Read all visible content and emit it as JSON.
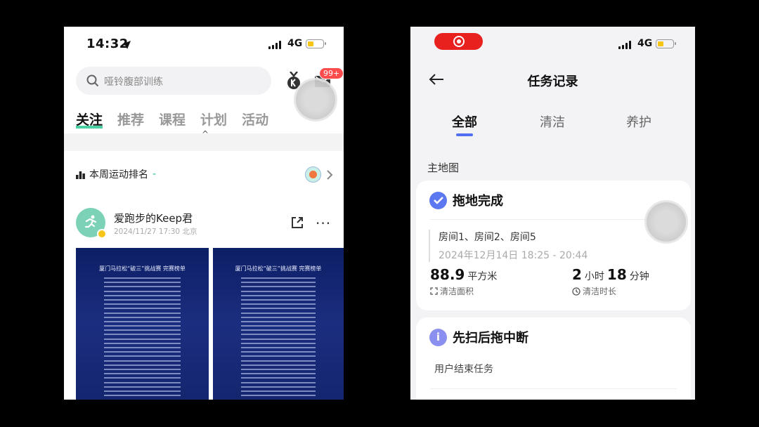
{
  "left": {
    "status": {
      "time": "14:32",
      "network": "4G"
    },
    "search": {
      "placeholder": "哑铃腹部训练"
    },
    "badge": "99+",
    "tabs": [
      "关注",
      "推荐",
      "课程",
      "计划",
      "活动"
    ],
    "band_glyph": "^",
    "ranking": {
      "title": "本周运动排名",
      "dash": "-"
    },
    "post": {
      "name": "爱跑步的Keep君",
      "meta": "2024/11/27 17:30 北京",
      "more": "···"
    },
    "posters": [
      {
        "title": "厦门马拉松“破三”挑战赛 完赛榜单"
      },
      {
        "title": "厦门马拉松“破三”挑战赛 完赛榜单"
      }
    ],
    "colors": {
      "accent": "#1dc48f",
      "badge": "#ff4b4b"
    }
  },
  "right": {
    "status": {
      "network": "4G"
    },
    "title": "任务记录",
    "tabs": [
      "全部",
      "清洁",
      "养护"
    ],
    "section": "主地图",
    "card1": {
      "title": "拖地完成",
      "rooms": "房间1、房间2、房间5",
      "time_range": "2024年12月14日 18:25 - 20:44",
      "area_value": "88.9",
      "area_unit": "平方米",
      "area_label": "清洁面积",
      "dur_hours": "2",
      "dur_hours_unit": "小时",
      "dur_mins": "18",
      "dur_mins_unit": "分钟",
      "dur_label": "清洁时长"
    },
    "card2": {
      "title": "先扫后拖中断",
      "status": "用户结束任务"
    },
    "colors": {
      "accent": "#5b78f0",
      "record": "#e8211f"
    }
  }
}
